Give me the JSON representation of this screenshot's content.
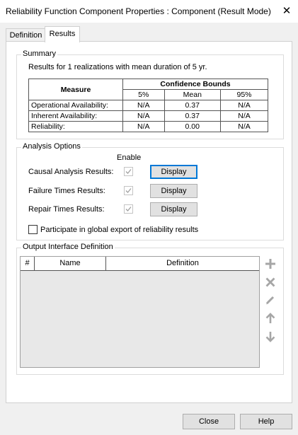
{
  "window": {
    "title": "Reliability Function Component Properties : Component (Result Mode)",
    "close_glyph": "✕"
  },
  "tabs": [
    {
      "label": "Definition",
      "active": false
    },
    {
      "label": "Results",
      "active": true
    }
  ],
  "summary": {
    "legend": "Summary",
    "text": "Results for 1 realizations with mean duration of 5 yr.",
    "table": {
      "header_measure": "Measure",
      "header_bounds": "Confidence Bounds",
      "sub_headers": [
        "5%",
        "Mean",
        "95%"
      ],
      "rows": [
        {
          "measure": "Operational Availability:",
          "p5": "N/A",
          "mean": "0.37",
          "p95": "N/A"
        },
        {
          "measure": "Inherent Availability:",
          "p5": "N/A",
          "mean": "0.37",
          "p95": "N/A"
        },
        {
          "measure": "Reliability:",
          "p5": "N/A",
          "mean": "0.00",
          "p95": "N/A"
        }
      ]
    }
  },
  "analysis": {
    "legend": "Analysis Options",
    "enable_label": "Enable",
    "rows": [
      {
        "label": "Causal Analysis Results:",
        "checked": true,
        "button": "Display"
      },
      {
        "label": "Failure Times Results:",
        "checked": true,
        "button": "Display"
      },
      {
        "label": "Repair Times Results:",
        "checked": true,
        "button": "Display"
      }
    ],
    "global_export_label": "Participate in global export of reliability results",
    "global_export_checked": false
  },
  "output": {
    "legend": "Output Interface Definition",
    "columns": [
      "#",
      "Name",
      "Definition"
    ],
    "icons": [
      "add-icon",
      "delete-icon",
      "edit-icon",
      "move-up-icon",
      "move-down-icon"
    ]
  },
  "footer": {
    "close_label": "Close",
    "help_label": "Help"
  },
  "colors": {
    "focus_border": "#0078d7",
    "icon_gray": "#a6a6a6"
  }
}
